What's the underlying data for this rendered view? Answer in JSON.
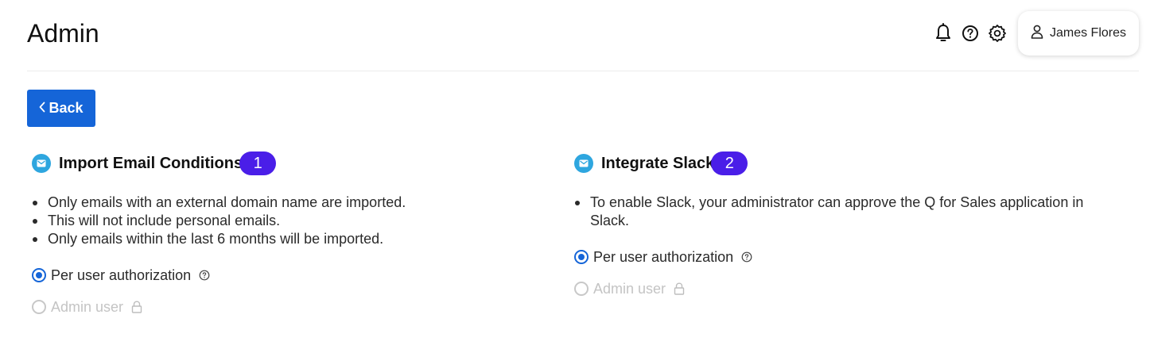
{
  "header": {
    "title": "Admin",
    "icons": [
      "bell-icon",
      "help-icon",
      "settings-icon"
    ],
    "user": {
      "icon": "user-icon",
      "name": "James Flores"
    }
  },
  "back_button": {
    "label": "Back",
    "icon": "chevron-left-icon"
  },
  "sections": [
    {
      "title": "Import Email Conditions",
      "badge": "1",
      "bullets": [
        "Only emails with an external domain name are imported.",
        "This will not include personal emails.",
        "Only emails within the last 6 months will be imported."
      ],
      "options": [
        {
          "label": "Per user authorization",
          "selected": true,
          "disabled": false,
          "icon": "help-icon"
        },
        {
          "label": "Admin user",
          "selected": false,
          "disabled": true,
          "icon": "lock-icon"
        }
      ]
    },
    {
      "title": "Integrate Slack",
      "badge": "2",
      "bullets": [
        "To enable Slack, your administrator can approve the Q for Sales application in Slack."
      ],
      "options": [
        {
          "label": "Per user authorization",
          "selected": true,
          "disabled": false,
          "icon": "help-icon"
        },
        {
          "label": "Admin user",
          "selected": false,
          "disabled": true,
          "icon": "lock-icon"
        }
      ]
    }
  ],
  "colors": {
    "primary": "#1565d8",
    "badge": "#4a1ee8",
    "mail_badge": "#2ea6df",
    "disabled": "#c4c4c4"
  }
}
